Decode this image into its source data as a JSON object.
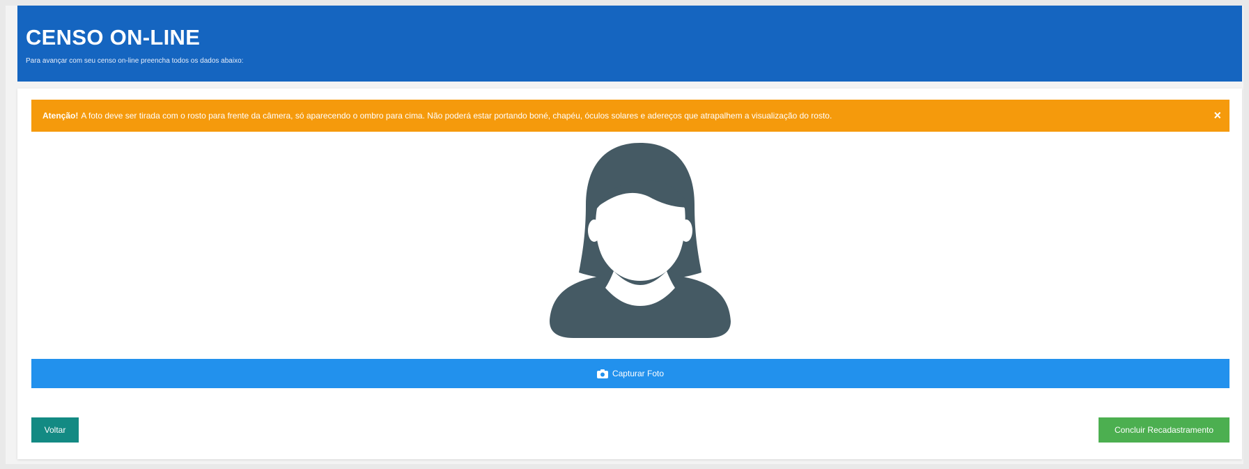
{
  "header": {
    "title": "CENSO ON-LINE",
    "subtitle": "Para avançar com seu censo on-line preencha todos os dados abaixo:"
  },
  "alert": {
    "strong": "Atenção!",
    "message": "A foto deve ser tirada com o rosto para frente da câmera, só aparecendo o ombro para cima. Não poderá estar portando boné, chapéu, óculos solares e adereços que atrapalhem a visualização do rosto.",
    "close_symbol": "×"
  },
  "avatar": {
    "icon": "female-user-placeholder-icon",
    "color": "#455a64"
  },
  "buttons": {
    "capture_label": "Capturar Foto",
    "capture_icon": "camera-icon",
    "back_label": "Voltar",
    "finish_label": "Concluir Recadastramento"
  },
  "colors": {
    "header": "#1565c0",
    "alert": "#f59a0c",
    "capture": "#2291ed",
    "back": "#138a83",
    "finish": "#4caf50"
  }
}
